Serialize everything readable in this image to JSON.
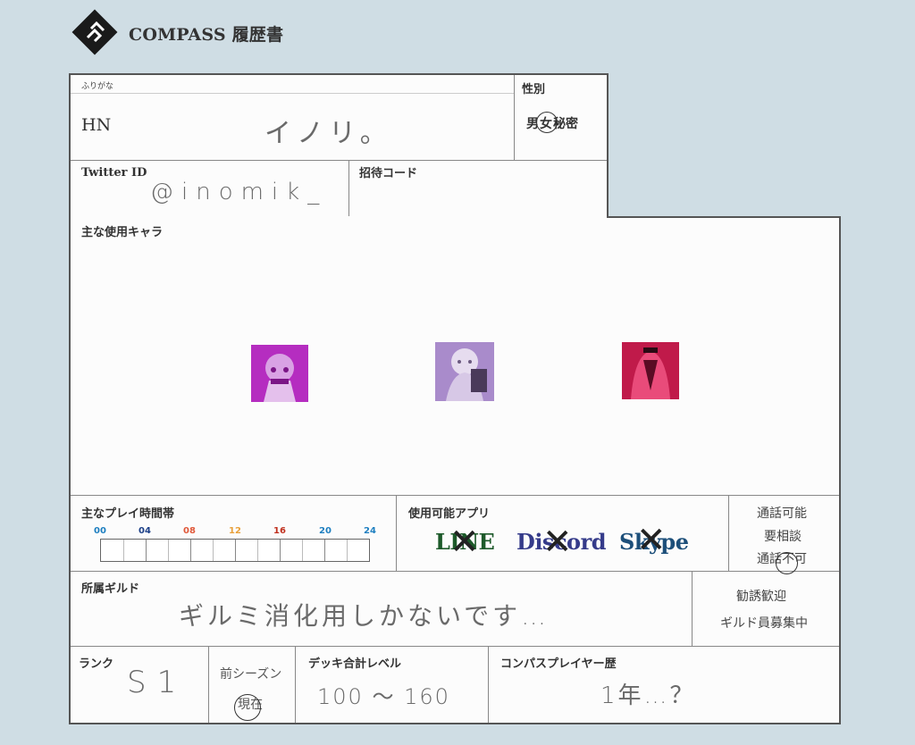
{
  "header": {
    "title": "COMPASS 履歴書"
  },
  "fields": {
    "furigana_label": "ふりがな",
    "hn_label": "HN",
    "hn_value": "イノリ。",
    "gender": {
      "label": "性別",
      "options": [
        "男",
        "女",
        "秘密"
      ],
      "selected": "女"
    },
    "twitter_label": "Twitter ID",
    "twitter_value": "@inomik_",
    "invite_label": "招待コード",
    "invite_value": ""
  },
  "characters": {
    "label": "主な使用キャラ",
    "items": [
      {
        "icon": "character-1-icon",
        "color": "#b52dc0"
      },
      {
        "icon": "character-2-icon",
        "color": "#a98bcb"
      },
      {
        "icon": "character-3-icon",
        "color": "#c01a4a"
      }
    ]
  },
  "playtime": {
    "label": "主なプレイ時間帯",
    "ticks": [
      "00",
      "04",
      "08",
      "12",
      "16",
      "20",
      "24"
    ],
    "tick_colors": [
      "#1e7fc0",
      "#1b3f87",
      "#e0593a",
      "#e8a03a",
      "#c0301e",
      "#1e7fc0",
      "#1e7fc0"
    ]
  },
  "apps": {
    "label": "使用可能アプリ",
    "items": [
      {
        "name": "LINE",
        "color": "#1d5a2a",
        "crossed": true
      },
      {
        "name": "Discord",
        "color": "#353b8a",
        "crossed": true
      },
      {
        "name": "Skype",
        "color": "#1d4f7a",
        "crossed": true
      }
    ]
  },
  "call": {
    "options": [
      "通話可能",
      "要相談",
      "通話不可"
    ],
    "selected": "通話不可"
  },
  "guild": {
    "label": "所属ギルド",
    "value": "ギルミ消化用しかないです…",
    "options": [
      "勧誘歓迎",
      "ギルド員募集中"
    ]
  },
  "rank": {
    "label": "ランク",
    "value": "S1",
    "season_options": [
      "前シーズン",
      "現在"
    ],
    "season_selected": "現在"
  },
  "deck": {
    "label": "デッキ合計レベル",
    "value": "100 〜 160"
  },
  "history": {
    "label": "コンパスプレイヤー歴",
    "value": "1年…？"
  }
}
